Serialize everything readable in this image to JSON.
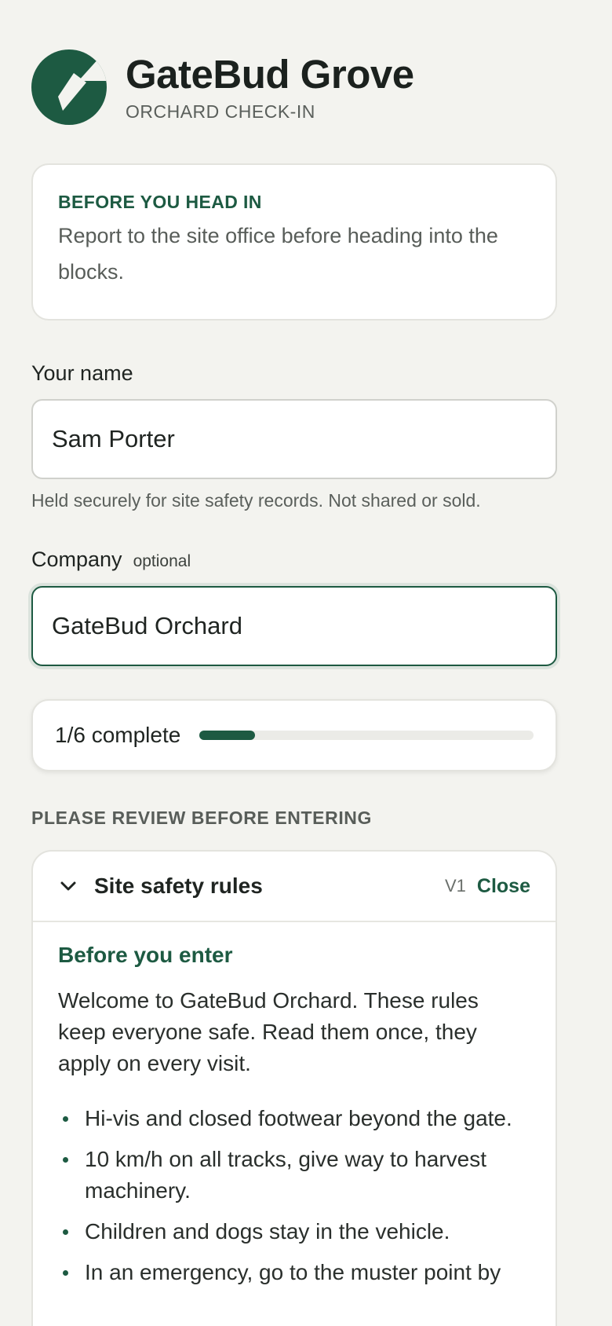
{
  "brand": {
    "title": "GateBud Grove",
    "subtitle": "ORCHARD CHECK-IN",
    "logo_icon": "leaf-logo-icon",
    "accent_color": "#1d5a42"
  },
  "notice": {
    "heading": "BEFORE YOU HEAD IN",
    "body": "Report to the site office before heading into the blocks."
  },
  "form": {
    "name_label": "Your name",
    "name_value": "Sam Porter",
    "name_hint": "Held securely for site safety records. Not shared or sold.",
    "company_label": "Company",
    "company_optional": "optional",
    "company_value": "GateBud Orchard"
  },
  "progress": {
    "label": "1/6 complete",
    "completed": 1,
    "total": 6
  },
  "section_title": "PLEASE REVIEW BEFORE ENTERING",
  "rules": {
    "title": "Site safety rules",
    "version": "V1",
    "close_label": "Close",
    "subheading": "Before you enter",
    "intro": "Welcome to GateBud Orchard. These rules keep everyone safe. Read them once, they apply on every visit.",
    "items": [
      "Hi-vis and closed footwear beyond the gate.",
      "10 km/h on all tracks, give way to harvest machinery.",
      "Children and dogs stay in the vehicle.",
      "In an emergency, go to the muster point by"
    ]
  }
}
